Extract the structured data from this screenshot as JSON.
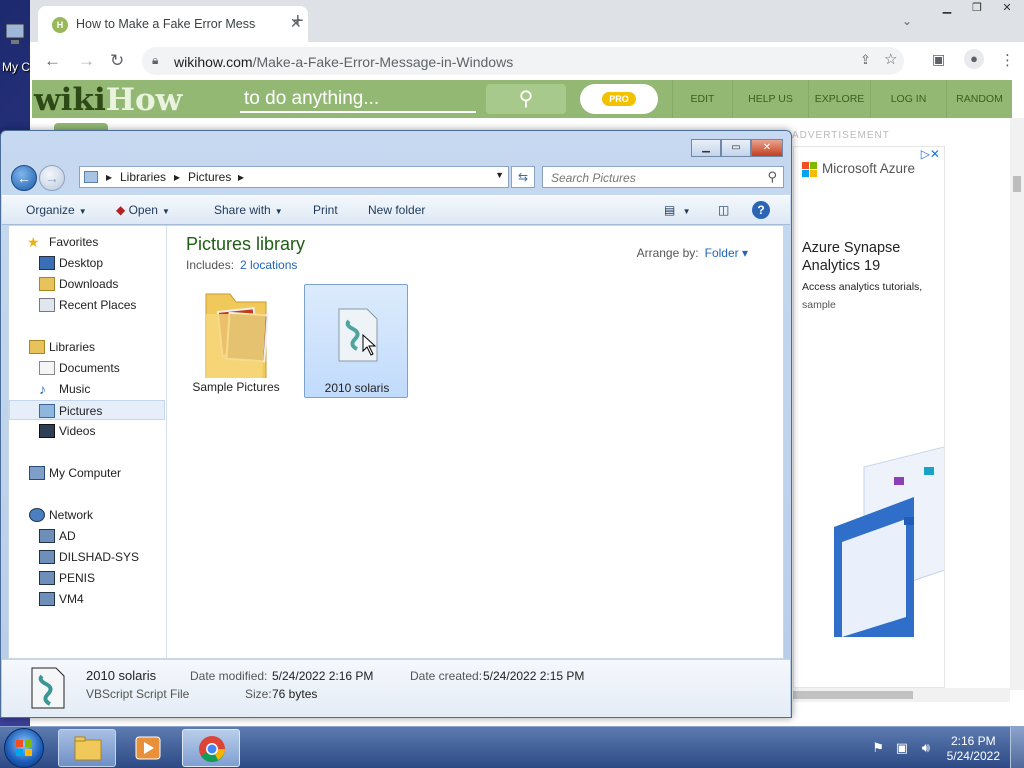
{
  "desktop": {
    "icon_label": "My C"
  },
  "browser": {
    "tab_title": "How to Make a Fake Error Message in Windows",
    "tab_favicon": "H",
    "url_domain": "wikihow.com",
    "url_path": "/Make-a-Fake-Error-Message-in-Windows"
  },
  "wikihow": {
    "logo_wiki": "wiki",
    "logo_how": "How",
    "search_placeholder": "to do anything...",
    "pro_label": "PRO",
    "nav": [
      "EDIT",
      "HELP US",
      "EXPLORE",
      "LOG IN",
      "RANDOM"
    ],
    "ad_label": "ADVERTISEMENT"
  },
  "ad": {
    "brand": "Microsoft Azure",
    "headline": "Azure Synapse Analytics 19",
    "line1": "Access analytics tutorials,",
    "line2": "sample"
  },
  "explorer": {
    "breadcrumb": [
      "Libraries",
      "Pictures"
    ],
    "search_placeholder": "Search Pictures",
    "commands": {
      "organize": "Organize",
      "open": "Open",
      "share": "Share with",
      "print": "Print",
      "new_folder": "New folder"
    },
    "nav": {
      "favorites": "Favorites",
      "desktop": "Desktop",
      "downloads": "Downloads",
      "recent": "Recent Places",
      "libraries": "Libraries",
      "documents": "Documents",
      "music": "Music",
      "pictures": "Pictures",
      "videos": "Videos",
      "computer": "My Computer",
      "network": "Network",
      "net_items": [
        "AD",
        "DILSHAD-SYS",
        "PENIS",
        "VM4"
      ]
    },
    "library_title": "Pictures library",
    "includes_label": "Includes:",
    "includes_link": "2 locations",
    "arrange_label": "Arrange by:",
    "arrange_value": "Folder",
    "items": [
      {
        "name": "Sample Pictures",
        "selected": false
      },
      {
        "name": "2010 solaris",
        "selected": true
      }
    ],
    "details": {
      "name": "2010 solaris",
      "type": "VBScript Script File",
      "modified_label": "Date modified:",
      "modified": "5/24/2022 2:16 PM",
      "size_label": "Size:",
      "size": "76 bytes",
      "created_label": "Date created:",
      "created": "5/24/2022 2:15 PM"
    }
  },
  "taskbar": {
    "time": "2:16 PM",
    "date": "5/24/2022"
  },
  "colors": {
    "wikihow_green": "#93b874",
    "library_title": "#1e5d13",
    "link": "#2266b8"
  }
}
